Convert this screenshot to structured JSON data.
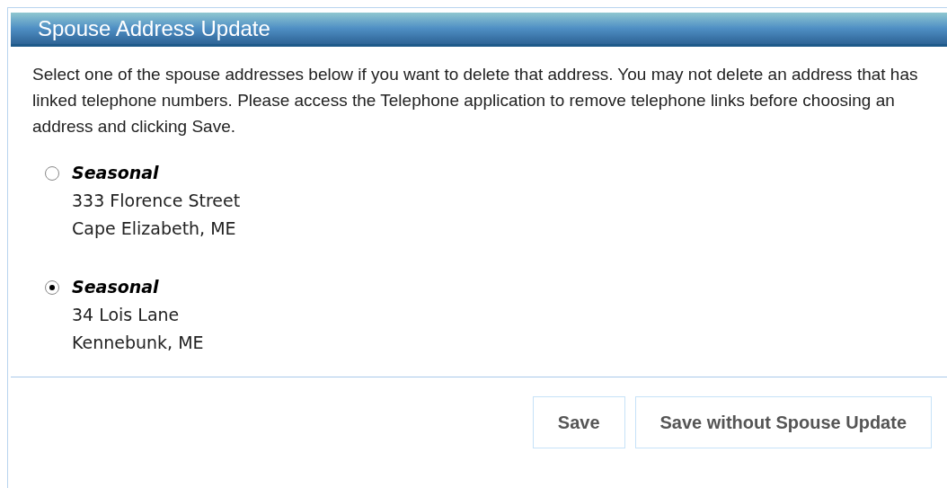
{
  "panel": {
    "title": "Spouse Address Update"
  },
  "instructions": "Select one of the spouse addresses below if you want to delete that address. You may not delete an address that has linked telephone numbers. Please access the Telephone application to remove telephone links before choosing an address and clicking Save.",
  "addresses": [
    {
      "type": "Seasonal",
      "street": "333 Florence Street",
      "city": "Cape Elizabeth, ME",
      "selected": false
    },
    {
      "type": "Seasonal",
      "street": "34 Lois Lane",
      "city": "Kennebunk, ME",
      "selected": true
    }
  ],
  "buttons": [
    "Save",
    "Save without Spouse Update"
  ]
}
